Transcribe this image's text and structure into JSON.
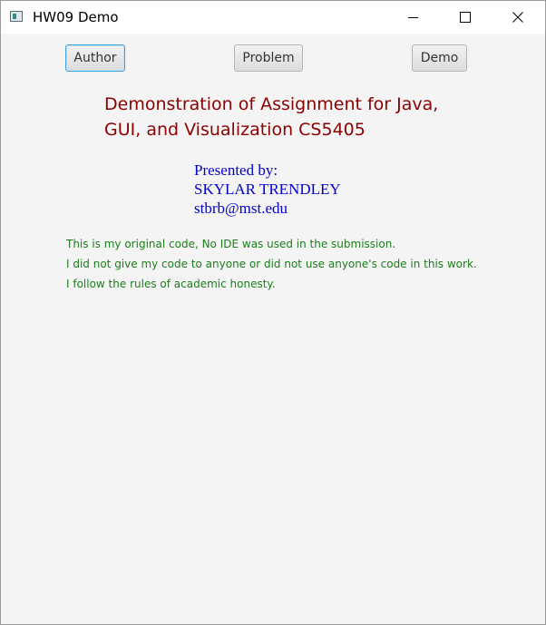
{
  "window": {
    "title": "HW09 Demo",
    "icon": "java-app-icon"
  },
  "toolbar": {
    "author_label": "Author",
    "problem_label": "Problem",
    "demo_label": "Demo",
    "selected": "Author"
  },
  "content": {
    "heading_line1": "Demonstration of Assignment for Java,",
    "heading_line2": "GUI, and Visualization CS5405",
    "presented_by": "Presented by:",
    "author_name": "SKYLAR TRENDLEY",
    "author_email": "stbrb@mst.edu",
    "statements": [
      "This is my original code, No IDE was used in the submission.",
      "I did not give my code to anyone or did not use anyone's code in this work.",
      "I follow the rules of academic honesty."
    ]
  },
  "colors": {
    "heading": "#8b0000",
    "author": "#0000cd",
    "statements": "#1a7f1a",
    "selected_button_border": "#3fa0e6"
  }
}
